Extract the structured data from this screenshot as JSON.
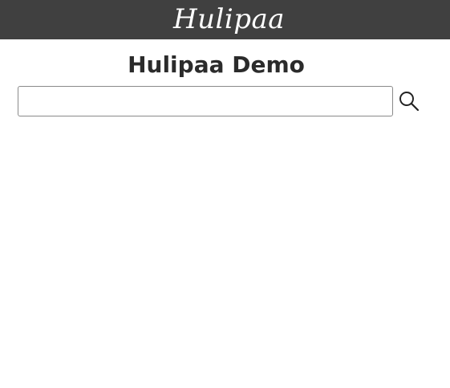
{
  "header": {
    "brand": "Hulipaa"
  },
  "main": {
    "title": "Hulipaa Demo"
  },
  "search": {
    "value": "",
    "placeholder": "",
    "button_icon": "search-icon"
  }
}
